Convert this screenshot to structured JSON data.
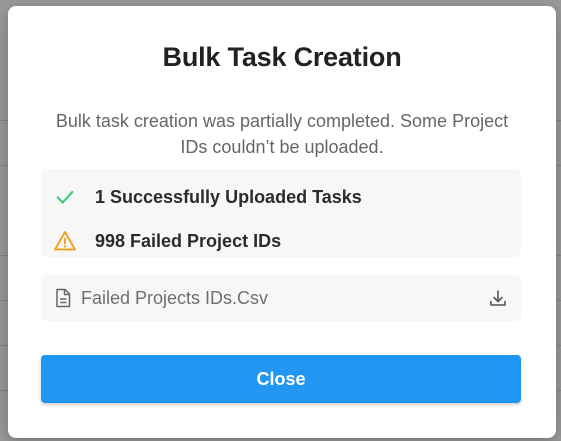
{
  "modal": {
    "title": "Bulk Task Creation",
    "description": "Bulk task creation was partially completed. Some Project IDs couldn’t be uploaded.",
    "results": [
      {
        "icon": "check-icon",
        "text": "1 Successfully Uploaded Tasks",
        "color": "#2ecc71"
      },
      {
        "icon": "warning-icon",
        "text": "998 Failed Project IDs",
        "color": "#f39c12"
      }
    ],
    "file": {
      "icon": "file-icon",
      "name": "Failed Projects IDs.Csv",
      "download_icon": "download-icon"
    },
    "close_label": "Close"
  },
  "colors": {
    "accent": "#2196f3",
    "success": "#2ecc71",
    "warning": "#f39c12"
  }
}
